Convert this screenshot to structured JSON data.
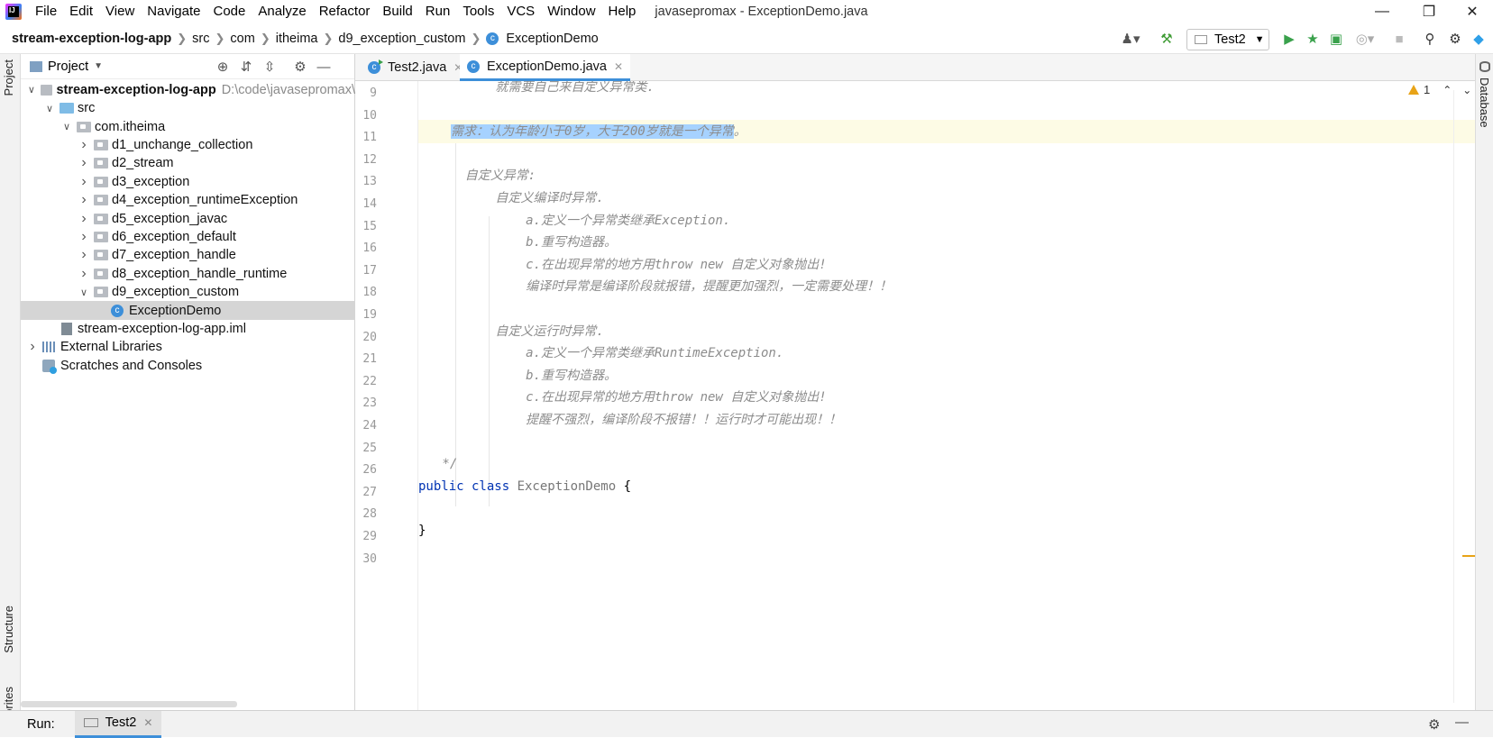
{
  "window": {
    "title": "javasepromax - ExceptionDemo.java",
    "logo": "IJ"
  },
  "menu": [
    "File",
    "Edit",
    "View",
    "Navigate",
    "Code",
    "Analyze",
    "Refactor",
    "Build",
    "Run",
    "Tools",
    "VCS",
    "Window",
    "Help"
  ],
  "breadcrumb": [
    "stream-exception-log-app",
    "src",
    "com",
    "itheima",
    "d9_exception_custom",
    "ExceptionDemo"
  ],
  "toolbar": {
    "run_config": "Test2"
  },
  "side_tabs": {
    "left_top": "Project",
    "left_mid": "Structure",
    "left_bottom": "Favorites",
    "right": "Database"
  },
  "project_panel": {
    "title": "Project",
    "tree": [
      {
        "label": "stream-exception-log-app",
        "suffix": "D:\\code\\javasepromax\\",
        "depth": 0,
        "expanded": true,
        "icon": "folder"
      },
      {
        "label": "src",
        "depth": 1,
        "expanded": true,
        "icon": "folder-blue"
      },
      {
        "label": "com.itheima",
        "depth": 2,
        "expanded": true,
        "icon": "package"
      },
      {
        "label": "d1_unchange_collection",
        "depth": 3,
        "expanded": false,
        "icon": "package"
      },
      {
        "label": "d2_stream",
        "depth": 3,
        "expanded": false,
        "icon": "package"
      },
      {
        "label": "d3_exception",
        "depth": 3,
        "expanded": false,
        "icon": "package"
      },
      {
        "label": "d4_exception_runtimeException",
        "depth": 3,
        "expanded": false,
        "icon": "package"
      },
      {
        "label": "d5_exception_javac",
        "depth": 3,
        "expanded": false,
        "icon": "package"
      },
      {
        "label": "d6_exception_default",
        "depth": 3,
        "expanded": false,
        "icon": "package"
      },
      {
        "label": "d7_exception_handle",
        "depth": 3,
        "expanded": false,
        "icon": "package"
      },
      {
        "label": "d8_exception_handle_runtime",
        "depth": 3,
        "expanded": false,
        "icon": "package"
      },
      {
        "label": "d9_exception_custom",
        "depth": 3,
        "expanded": true,
        "icon": "package"
      },
      {
        "label": "ExceptionDemo",
        "depth": 4,
        "icon": "class",
        "selected": true
      },
      {
        "label": "stream-exception-log-app.iml",
        "depth": 1,
        "icon": "iml"
      },
      {
        "label": "External Libraries",
        "depth": 0,
        "expanded": false,
        "icon": "library"
      },
      {
        "label": "Scratches and Consoles",
        "depth": 0,
        "icon": "scratch"
      }
    ]
  },
  "tabs": [
    {
      "label": "Test2.java",
      "active": false
    },
    {
      "label": "ExceptionDemo.java",
      "active": true
    }
  ],
  "inspection": {
    "warnings": "1"
  },
  "editor": {
    "lines": [
      {
        "n": "9",
        "text": "        就需要自己来自定义异常类.",
        "type": "comment"
      },
      {
        "n": "10",
        "text": "",
        "type": "blank"
      },
      {
        "n": "11",
        "text": "需求：认为年龄小于0岁，大于200岁就是一个异常",
        "tail": "。",
        "type": "selected"
      },
      {
        "n": "12",
        "text": "",
        "type": "blank"
      },
      {
        "n": "13",
        "text": "    自定义异常:",
        "type": "comment"
      },
      {
        "n": "14",
        "text": "        自定义编译时异常.",
        "type": "comment"
      },
      {
        "n": "15",
        "text": "            a.定义一个异常类继承Exception.",
        "type": "comment"
      },
      {
        "n": "16",
        "text": "            b.重写构造器。",
        "type": "comment"
      },
      {
        "n": "17",
        "text": "            c.在出现异常的地方用throw new 自定义对象抛出!",
        "type": "comment"
      },
      {
        "n": "18",
        "text": "            编译时异常是编译阶段就报错，提醒更加强烈，一定需要处理！！",
        "type": "comment"
      },
      {
        "n": "19",
        "text": "",
        "type": "blank"
      },
      {
        "n": "20",
        "text": "        自定义运行时异常.",
        "type": "comment"
      },
      {
        "n": "21",
        "text": "            a.定义一个异常类继承RuntimeException.",
        "type": "comment"
      },
      {
        "n": "22",
        "text": "            b.重写构造器。",
        "type": "comment"
      },
      {
        "n": "23",
        "text": "            c.在出现异常的地方用throw new 自定义对象抛出!",
        "type": "comment"
      },
      {
        "n": "24",
        "text": "            提醒不强烈，编译阶段不报错！！运行时才可能出现！！",
        "type": "comment"
      },
      {
        "n": "25",
        "text": "",
        "type": "blank"
      },
      {
        "n": "26",
        "text": " */",
        "type": "comment"
      },
      {
        "n": "27",
        "kw": "public class ",
        "cls": "ExceptionDemo",
        "text": " {",
        "type": "code"
      },
      {
        "n": "28",
        "text": "",
        "type": "blank"
      },
      {
        "n": "29",
        "text": "}",
        "type": "code"
      },
      {
        "n": "30",
        "text": "",
        "type": "blank"
      }
    ]
  },
  "run_bar": {
    "label": "Run:",
    "tab": "Test2"
  }
}
